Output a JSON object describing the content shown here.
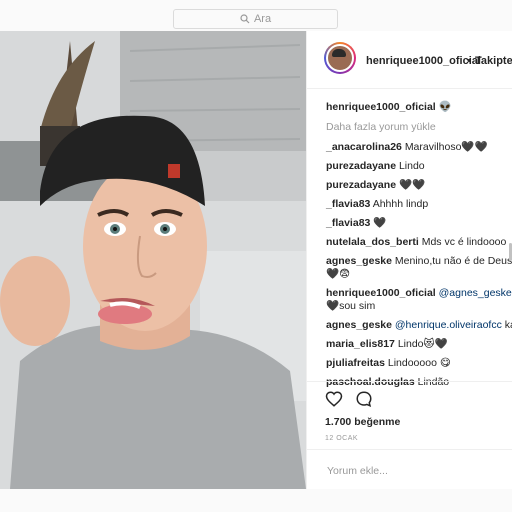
{
  "search": {
    "placeholder": "Ara",
    "icon": "search-icon"
  },
  "post": {
    "username": "henriquee1000_oficial",
    "separator": "•",
    "follow_label": "Takipte",
    "caption_user": "henriquee1000_oficial",
    "load_more": "Daha fazla yorum yükle",
    "comments": [
      {
        "user": "_anacarolina26",
        "text": "Maravilhoso🖤🖤"
      },
      {
        "user": "purezadayane",
        "text": "Lindo"
      },
      {
        "user": "purezadayane",
        "text": "🖤🖤"
      },
      {
        "user": "_flavia83",
        "text": "Ahhhh lindp"
      },
      {
        "user": "_flavia83",
        "text": "🖤"
      },
      {
        "user": "nutelala_dos_berti",
        "text": "Mds vc é lindoooo"
      },
      {
        "user": "agnes_geske",
        "text": "Menino,tu não é de Deus n"
      },
      {
        "user": "",
        "text": "🖤😨"
      },
      {
        "user": "henriquee1000_oficial",
        "mention": "@agnes_geske",
        "text": " u"
      },
      {
        "user": "",
        "text": "🖤sou sim"
      },
      {
        "user": "agnes_geske",
        "mention": "@henrique.oliveiraofcc",
        "text": " kal"
      },
      {
        "user": "maria_elis817",
        "text": "Lindo😻🖤"
      },
      {
        "user": "pjuliafreitas",
        "text": "Lindooooo 😋"
      },
      {
        "user": "paschoal.douglas",
        "text": "Lindão"
      }
    ],
    "likes": "1.700 beğenme",
    "date": "12 OCAK",
    "comment_placeholder": "Yorum ekle...",
    "caption_emoji": "👽"
  },
  "colors": {
    "link": "#003569",
    "muted": "#999999",
    "text": "#262626",
    "border": "#efefef"
  }
}
